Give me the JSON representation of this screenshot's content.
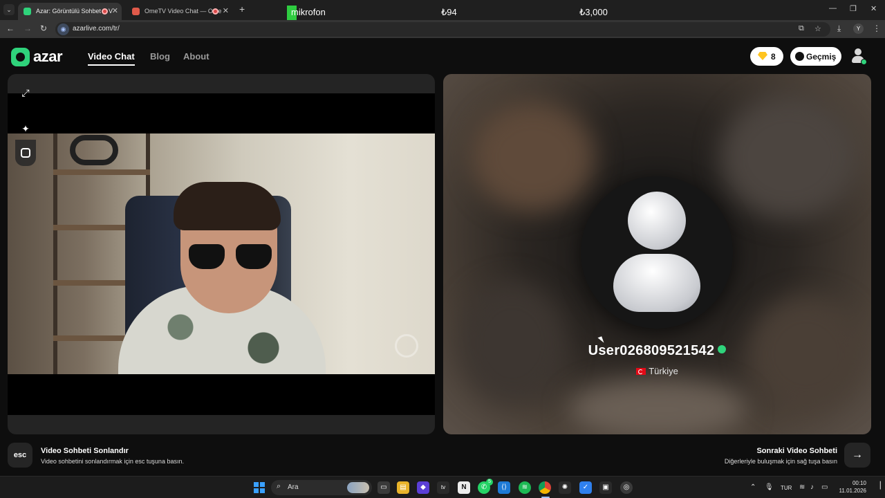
{
  "browser": {
    "tabs": [
      {
        "title": "Azar: Görüntülü Sohbet & V",
        "active": true
      },
      {
        "title": "OmeTV Video Chat — Ome",
        "active": false
      }
    ],
    "new_tab": "+",
    "overlay": {
      "mic_label": "mikrofon",
      "amount_1": "₺94",
      "amount_2": "₺3,000"
    },
    "url": "azarlive.com/tr/",
    "profile_initial": "Y"
  },
  "app": {
    "logo_text": "azar",
    "nav": [
      {
        "label": "Video Chat",
        "active": true
      },
      {
        "label": "Blog",
        "active": false
      },
      {
        "label": "About",
        "active": false
      }
    ],
    "gems": "8",
    "history_label": "Geçmiş"
  },
  "partner": {
    "username": "User026809521542",
    "country": "Türkiye"
  },
  "footer": {
    "esc_key": "esc",
    "end_title": "Video Sohbeti Sonlandır",
    "end_sub": "Video sohbetini sonlandırmak için esc tuşuna basın.",
    "next_title": "Sonraki Video Sohbeti",
    "next_sub": "Diğerleriyle buluşmak için sağ tuşa basın"
  },
  "taskbar": {
    "search_label": "Ara",
    "tray_lang": "TUR",
    "whatsapp_badge": "5",
    "time": "00:10",
    "date": "11.01.2026"
  },
  "colors": {
    "brand": "#2fd37b",
    "gem": "#ffc41f",
    "record": "#d94848"
  },
  "icons": {
    "expand": "expand-icon",
    "effects": "sparkles-icon",
    "filter": "face-filter-icon",
    "next": "arrow-right-icon"
  }
}
